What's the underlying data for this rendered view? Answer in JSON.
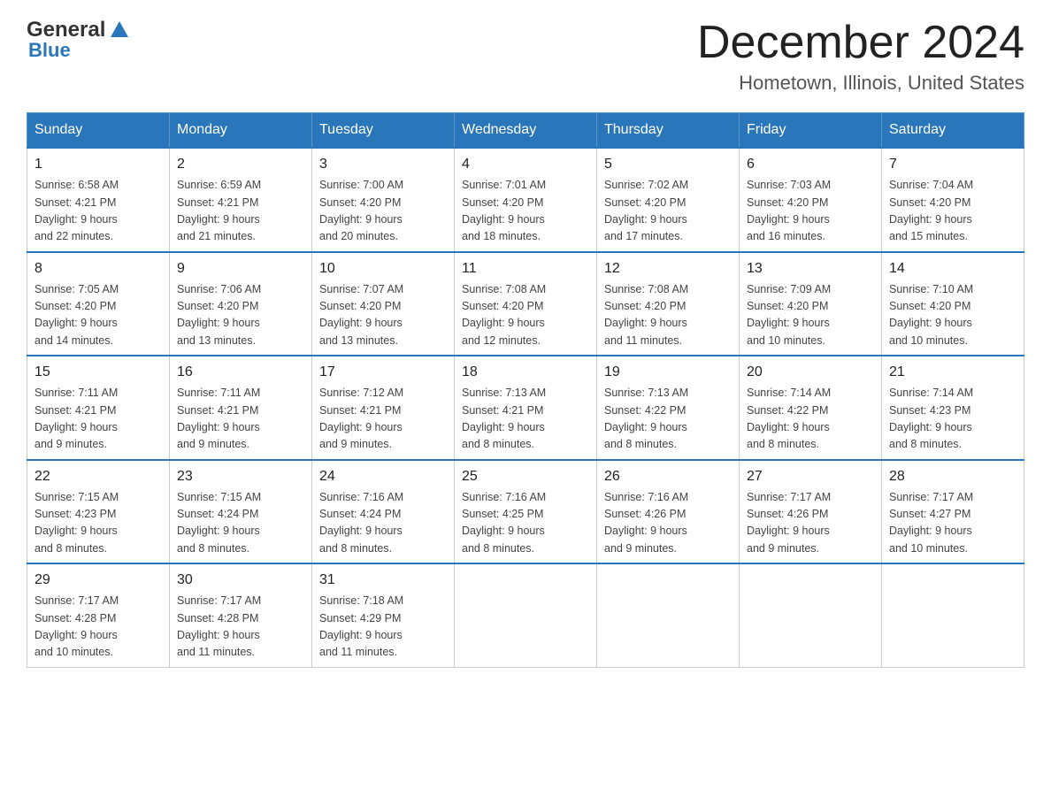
{
  "header": {
    "logo": {
      "general": "General",
      "blue": "Blue"
    },
    "title": "December 2024",
    "subtitle": "Hometown, Illinois, United States"
  },
  "days_of_week": [
    "Sunday",
    "Monday",
    "Tuesday",
    "Wednesday",
    "Thursday",
    "Friday",
    "Saturday"
  ],
  "weeks": [
    [
      {
        "day": "1",
        "sunrise": "6:58 AM",
        "sunset": "4:21 PM",
        "daylight": "9 hours and 22 minutes."
      },
      {
        "day": "2",
        "sunrise": "6:59 AM",
        "sunset": "4:21 PM",
        "daylight": "9 hours and 21 minutes."
      },
      {
        "day": "3",
        "sunrise": "7:00 AM",
        "sunset": "4:20 PM",
        "daylight": "9 hours and 20 minutes."
      },
      {
        "day": "4",
        "sunrise": "7:01 AM",
        "sunset": "4:20 PM",
        "daylight": "9 hours and 18 minutes."
      },
      {
        "day": "5",
        "sunrise": "7:02 AM",
        "sunset": "4:20 PM",
        "daylight": "9 hours and 17 minutes."
      },
      {
        "day": "6",
        "sunrise": "7:03 AM",
        "sunset": "4:20 PM",
        "daylight": "9 hours and 16 minutes."
      },
      {
        "day": "7",
        "sunrise": "7:04 AM",
        "sunset": "4:20 PM",
        "daylight": "9 hours and 15 minutes."
      }
    ],
    [
      {
        "day": "8",
        "sunrise": "7:05 AM",
        "sunset": "4:20 PM",
        "daylight": "9 hours and 14 minutes."
      },
      {
        "day": "9",
        "sunrise": "7:06 AM",
        "sunset": "4:20 PM",
        "daylight": "9 hours and 13 minutes."
      },
      {
        "day": "10",
        "sunrise": "7:07 AM",
        "sunset": "4:20 PM",
        "daylight": "9 hours and 13 minutes."
      },
      {
        "day": "11",
        "sunrise": "7:08 AM",
        "sunset": "4:20 PM",
        "daylight": "9 hours and 12 minutes."
      },
      {
        "day": "12",
        "sunrise": "7:08 AM",
        "sunset": "4:20 PM",
        "daylight": "9 hours and 11 minutes."
      },
      {
        "day": "13",
        "sunrise": "7:09 AM",
        "sunset": "4:20 PM",
        "daylight": "9 hours and 10 minutes."
      },
      {
        "day": "14",
        "sunrise": "7:10 AM",
        "sunset": "4:20 PM",
        "daylight": "9 hours and 10 minutes."
      }
    ],
    [
      {
        "day": "15",
        "sunrise": "7:11 AM",
        "sunset": "4:21 PM",
        "daylight": "9 hours and 9 minutes."
      },
      {
        "day": "16",
        "sunrise": "7:11 AM",
        "sunset": "4:21 PM",
        "daylight": "9 hours and 9 minutes."
      },
      {
        "day": "17",
        "sunrise": "7:12 AM",
        "sunset": "4:21 PM",
        "daylight": "9 hours and 9 minutes."
      },
      {
        "day": "18",
        "sunrise": "7:13 AM",
        "sunset": "4:21 PM",
        "daylight": "9 hours and 8 minutes."
      },
      {
        "day": "19",
        "sunrise": "7:13 AM",
        "sunset": "4:22 PM",
        "daylight": "9 hours and 8 minutes."
      },
      {
        "day": "20",
        "sunrise": "7:14 AM",
        "sunset": "4:22 PM",
        "daylight": "9 hours and 8 minutes."
      },
      {
        "day": "21",
        "sunrise": "7:14 AM",
        "sunset": "4:23 PM",
        "daylight": "9 hours and 8 minutes."
      }
    ],
    [
      {
        "day": "22",
        "sunrise": "7:15 AM",
        "sunset": "4:23 PM",
        "daylight": "9 hours and 8 minutes."
      },
      {
        "day": "23",
        "sunrise": "7:15 AM",
        "sunset": "4:24 PM",
        "daylight": "9 hours and 8 minutes."
      },
      {
        "day": "24",
        "sunrise": "7:16 AM",
        "sunset": "4:24 PM",
        "daylight": "9 hours and 8 minutes."
      },
      {
        "day": "25",
        "sunrise": "7:16 AM",
        "sunset": "4:25 PM",
        "daylight": "9 hours and 8 minutes."
      },
      {
        "day": "26",
        "sunrise": "7:16 AM",
        "sunset": "4:26 PM",
        "daylight": "9 hours and 9 minutes."
      },
      {
        "day": "27",
        "sunrise": "7:17 AM",
        "sunset": "4:26 PM",
        "daylight": "9 hours and 9 minutes."
      },
      {
        "day": "28",
        "sunrise": "7:17 AM",
        "sunset": "4:27 PM",
        "daylight": "9 hours and 10 minutes."
      }
    ],
    [
      {
        "day": "29",
        "sunrise": "7:17 AM",
        "sunset": "4:28 PM",
        "daylight": "9 hours and 10 minutes."
      },
      {
        "day": "30",
        "sunrise": "7:17 AM",
        "sunset": "4:28 PM",
        "daylight": "9 hours and 11 minutes."
      },
      {
        "day": "31",
        "sunrise": "7:18 AM",
        "sunset": "4:29 PM",
        "daylight": "9 hours and 11 minutes."
      },
      null,
      null,
      null,
      null
    ]
  ],
  "labels": {
    "sunrise": "Sunrise:",
    "sunset": "Sunset:",
    "daylight": "Daylight:"
  },
  "colors": {
    "header_bg": "#2a76bb",
    "header_text": "#ffffff",
    "border": "#aaaaaa",
    "cell_border": "#cccccc"
  }
}
